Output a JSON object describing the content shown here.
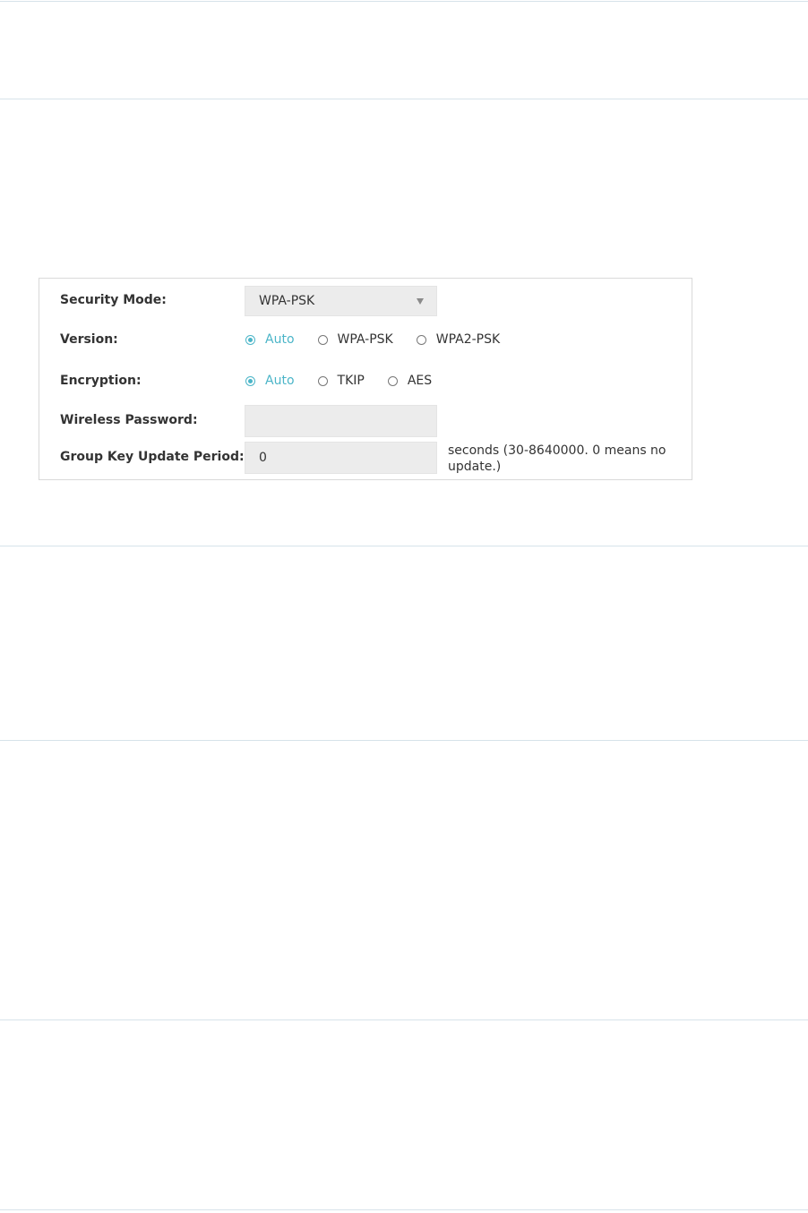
{
  "security_mode": {
    "label": "Security Mode:",
    "value": "WPA-PSK"
  },
  "version": {
    "label": "Version:",
    "options": [
      {
        "label": "Auto",
        "checked": true
      },
      {
        "label": "WPA-PSK",
        "checked": false
      },
      {
        "label": "WPA2-PSK",
        "checked": false
      }
    ]
  },
  "encryption": {
    "label": "Encryption:",
    "options": [
      {
        "label": "Auto",
        "checked": true
      },
      {
        "label": "TKIP",
        "checked": false
      },
      {
        "label": "AES",
        "checked": false
      }
    ]
  },
  "wireless_password": {
    "label": "Wireless Password:",
    "value": ""
  },
  "group_key": {
    "label": "Group Key Update Period:",
    "value": "0",
    "hint": "seconds (30-8640000. 0 means no update.)"
  },
  "colors": {
    "accent": "#4bb5c8",
    "divider": "#d7e3ea",
    "field_bg": "#ececec"
  }
}
